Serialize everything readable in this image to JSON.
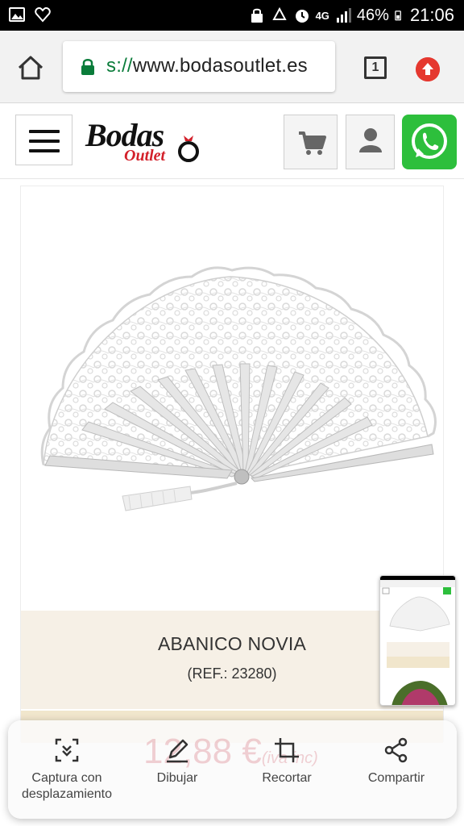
{
  "status_bar": {
    "network": "4G",
    "battery": "46%",
    "time": "21:06"
  },
  "browser": {
    "url_scheme": "s://",
    "url_host": "www.bodasoutlet.es",
    "tab_count": "1"
  },
  "site": {
    "logo_main": "Bodas",
    "logo_sub": "Outlet"
  },
  "product": {
    "title": "ABANICO NOVIA",
    "ref": "(REF.: 23280)",
    "price": "12,88 €",
    "price_tax": "(iva inc)"
  },
  "capture_toolbar": {
    "scroll_capture_line1": "Captura con",
    "scroll_capture_line2": "desplazamiento",
    "draw": "Dibujar",
    "crop": "Recortar",
    "share": "Compartir"
  },
  "colors": {
    "status_bar_bg": "#000000",
    "lock_green": "#0a7c3a",
    "update_red": "#e5382f",
    "whatsapp_green": "#2dbf3c",
    "product_info_bg": "#f6f0e6",
    "logo_red": "#d3202a"
  },
  "icons": [
    "gallery-icon",
    "heart-icon",
    "lock-status-icon",
    "recycle-icon",
    "alarm-icon",
    "signal-icon",
    "battery-icon",
    "home-icon",
    "lock-icon",
    "tab-switcher-icon",
    "update-icon",
    "hamburger-icon",
    "cart-icon",
    "user-icon",
    "whatsapp-icon",
    "scroll-capture-icon",
    "pen-icon",
    "crop-icon",
    "share-icon"
  ]
}
